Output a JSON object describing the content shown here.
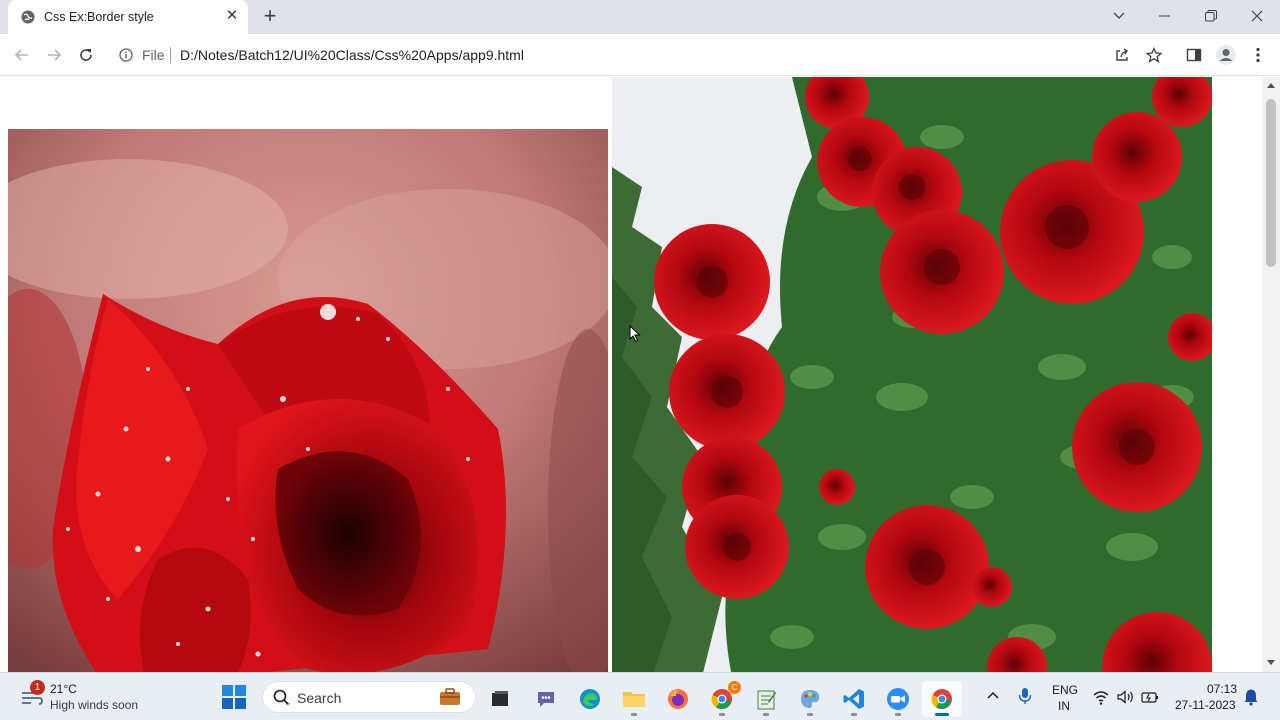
{
  "browser": {
    "tab": {
      "title": "Css Ex:Border style",
      "favicon": "globe-icon",
      "close_glyph": "✕"
    },
    "new_tab_glyph": "+",
    "address": {
      "scheme": "File",
      "url": "D:/Notes/Batch12/UI%20Class/Css%20Apps/app9.html"
    }
  },
  "page": {
    "images": [
      {
        "subject": "red-rose-with-dew"
      },
      {
        "subject": "red-rose-bush"
      }
    ]
  },
  "taskbar": {
    "weather": {
      "temp": "21°C",
      "desc": "High winds soon",
      "badge": "1"
    },
    "search_placeholder": "Search",
    "language": {
      "line1": "ENG",
      "line2": "IN"
    },
    "clock": {
      "time": "07:13",
      "date": "27-11-2023"
    },
    "apps": [
      "widgets",
      "file-explorer",
      "teams",
      "edge",
      "file-manager",
      "firefox",
      "chrome-profile",
      "notepad",
      "paint",
      "vscode",
      "zoom",
      "chrome"
    ],
    "chrome_profile_badge": "C"
  },
  "colors": {
    "tabstrip": "#dfe3e8",
    "taskbar": "#e9eef5",
    "accent": "#0067c0"
  }
}
